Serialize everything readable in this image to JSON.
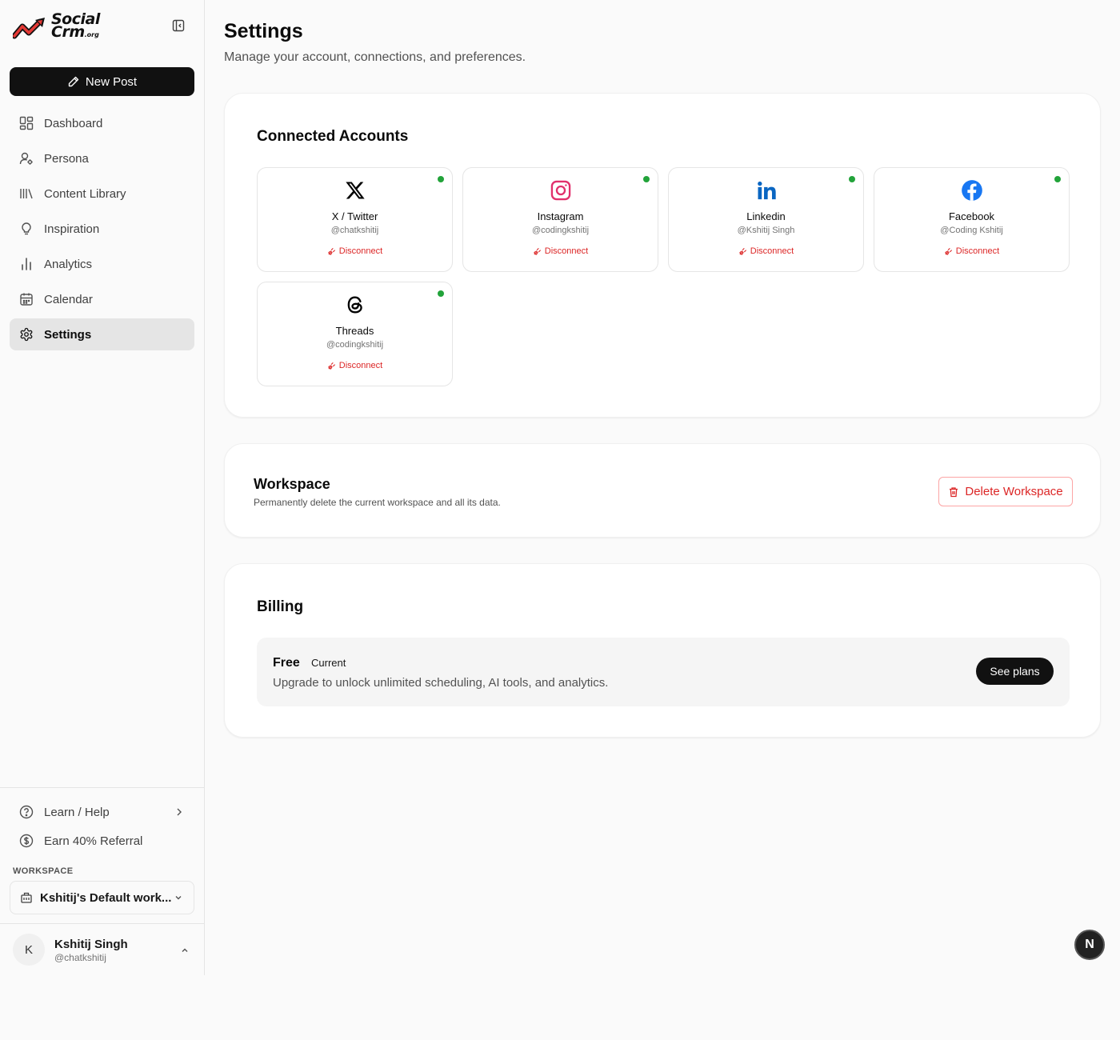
{
  "sidebar": {
    "logo_line1": "Social",
    "logo_line2": "Crm",
    "logo_suffix": ".org",
    "new_post": "New Post",
    "nav": [
      {
        "label": "Dashboard",
        "icon": "dashboard-icon"
      },
      {
        "label": "Persona",
        "icon": "persona-icon"
      },
      {
        "label": "Content Library",
        "icon": "library-icon"
      },
      {
        "label": "Inspiration",
        "icon": "lightbulb-icon"
      },
      {
        "label": "Analytics",
        "icon": "bar-chart-icon"
      },
      {
        "label": "Calendar",
        "icon": "calendar-icon"
      },
      {
        "label": "Settings",
        "icon": "gear-icon",
        "active": true
      }
    ],
    "learn_help": "Learn / Help",
    "referral": "Earn 40% Referral",
    "workspace_label": "WORKSPACE",
    "workspace_name": "Kshitij's Default work...",
    "user": {
      "initial": "K",
      "name": "Kshitij Singh",
      "handle": "@chatkshitij"
    }
  },
  "header": {
    "title": "Settings",
    "subtitle": "Manage your account, connections, and preferences."
  },
  "connected": {
    "title": "Connected Accounts",
    "disconnect_label": "Disconnect",
    "accounts": [
      {
        "name": "X / Twitter",
        "handle": "@chatkshitij",
        "icon": "x-twitter-icon",
        "connected": true
      },
      {
        "name": "Instagram",
        "handle": "@codingkshitij",
        "icon": "instagram-icon",
        "connected": true
      },
      {
        "name": "Linkedin",
        "handle": "@Kshitij Singh",
        "icon": "linkedin-icon",
        "connected": true
      },
      {
        "name": "Facebook",
        "handle": "@Coding Kshitij",
        "icon": "facebook-icon",
        "connected": true
      },
      {
        "name": "Threads",
        "handle": "@codingkshitij",
        "icon": "threads-icon",
        "connected": true
      }
    ]
  },
  "workspace": {
    "title": "Workspace",
    "description": "Permanently delete the current workspace and all its data.",
    "delete_label": "Delete Workspace"
  },
  "billing": {
    "title": "Billing",
    "plan": "Free",
    "badge": "Current",
    "description": "Upgrade to unlock unlimited scheduling, AI tools, and analytics.",
    "cta": "See plans"
  },
  "dev_badge": "N",
  "colors": {
    "accent": "#111111",
    "danger": "#dc2626",
    "connected": "#22a33a",
    "instagram": "#e1306c",
    "linkedin": "#0a66c2",
    "facebook": "#1877f2"
  }
}
